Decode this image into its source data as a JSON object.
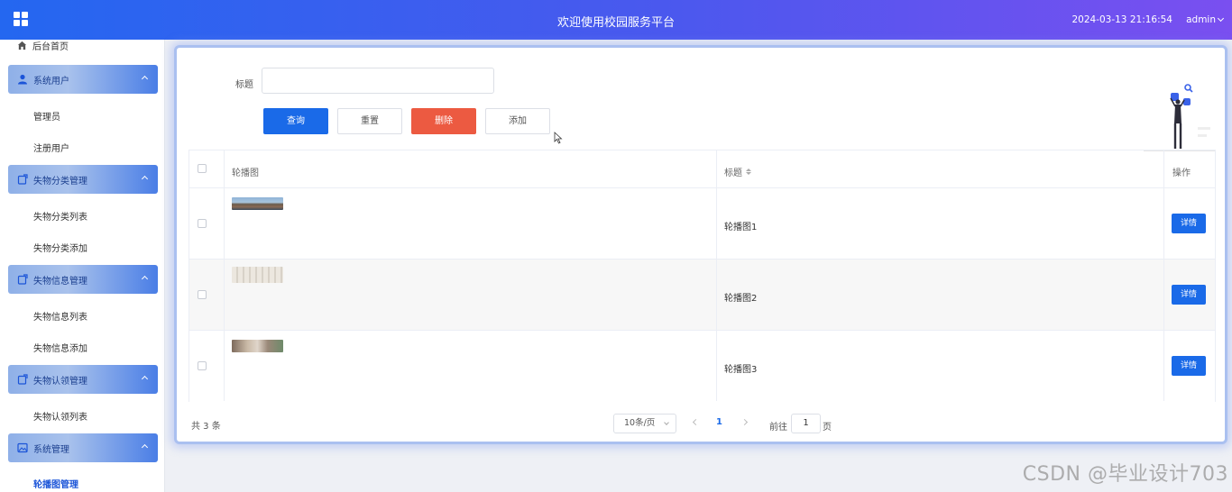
{
  "header": {
    "title": "欢迎使用校园服务平台",
    "datetime": "2024-03-13 21:16:54",
    "user": "admin"
  },
  "sidebar": {
    "home": "后台首页",
    "groups": [
      {
        "label": "系统用户",
        "icon": "user-icon",
        "items": [
          "管理员",
          "注册用户"
        ]
      },
      {
        "label": "失物分类管理",
        "icon": "tag-icon",
        "items": [
          "失物分类列表",
          "失物分类添加"
        ]
      },
      {
        "label": "失物信息管理",
        "icon": "tag-icon",
        "items": [
          "失物信息列表",
          "失物信息添加"
        ]
      },
      {
        "label": "失物认领管理",
        "icon": "tag-icon",
        "items": [
          "失物认领列表"
        ]
      },
      {
        "label": "系统管理",
        "icon": "image-icon",
        "items": [
          "轮播图管理"
        ]
      }
    ],
    "active_item": "轮播图管理"
  },
  "search": {
    "label": "标题",
    "value": "",
    "placeholder": ""
  },
  "buttons": {
    "query": "查询",
    "reset": "重置",
    "delete": "删除",
    "add": "添加"
  },
  "table": {
    "columns": [
      "轮播图",
      "标题",
      "操作"
    ],
    "rows": [
      {
        "title": "轮播图1",
        "action": "详情"
      },
      {
        "title": "轮播图2",
        "action": "详情"
      },
      {
        "title": "轮播图3",
        "action": "详情"
      }
    ]
  },
  "pagination": {
    "total": "共 3 条",
    "page_size": "10条/页",
    "current_page": "1",
    "goto_label": "前往",
    "goto_value": "1",
    "goto_unit": "页"
  },
  "watermark": "CSDN @毕业设计703",
  "colors": {
    "primary": "#1a6ae8",
    "danger": "#ec5a41",
    "header_start": "#2467f0",
    "header_end": "#7a4ff0"
  }
}
